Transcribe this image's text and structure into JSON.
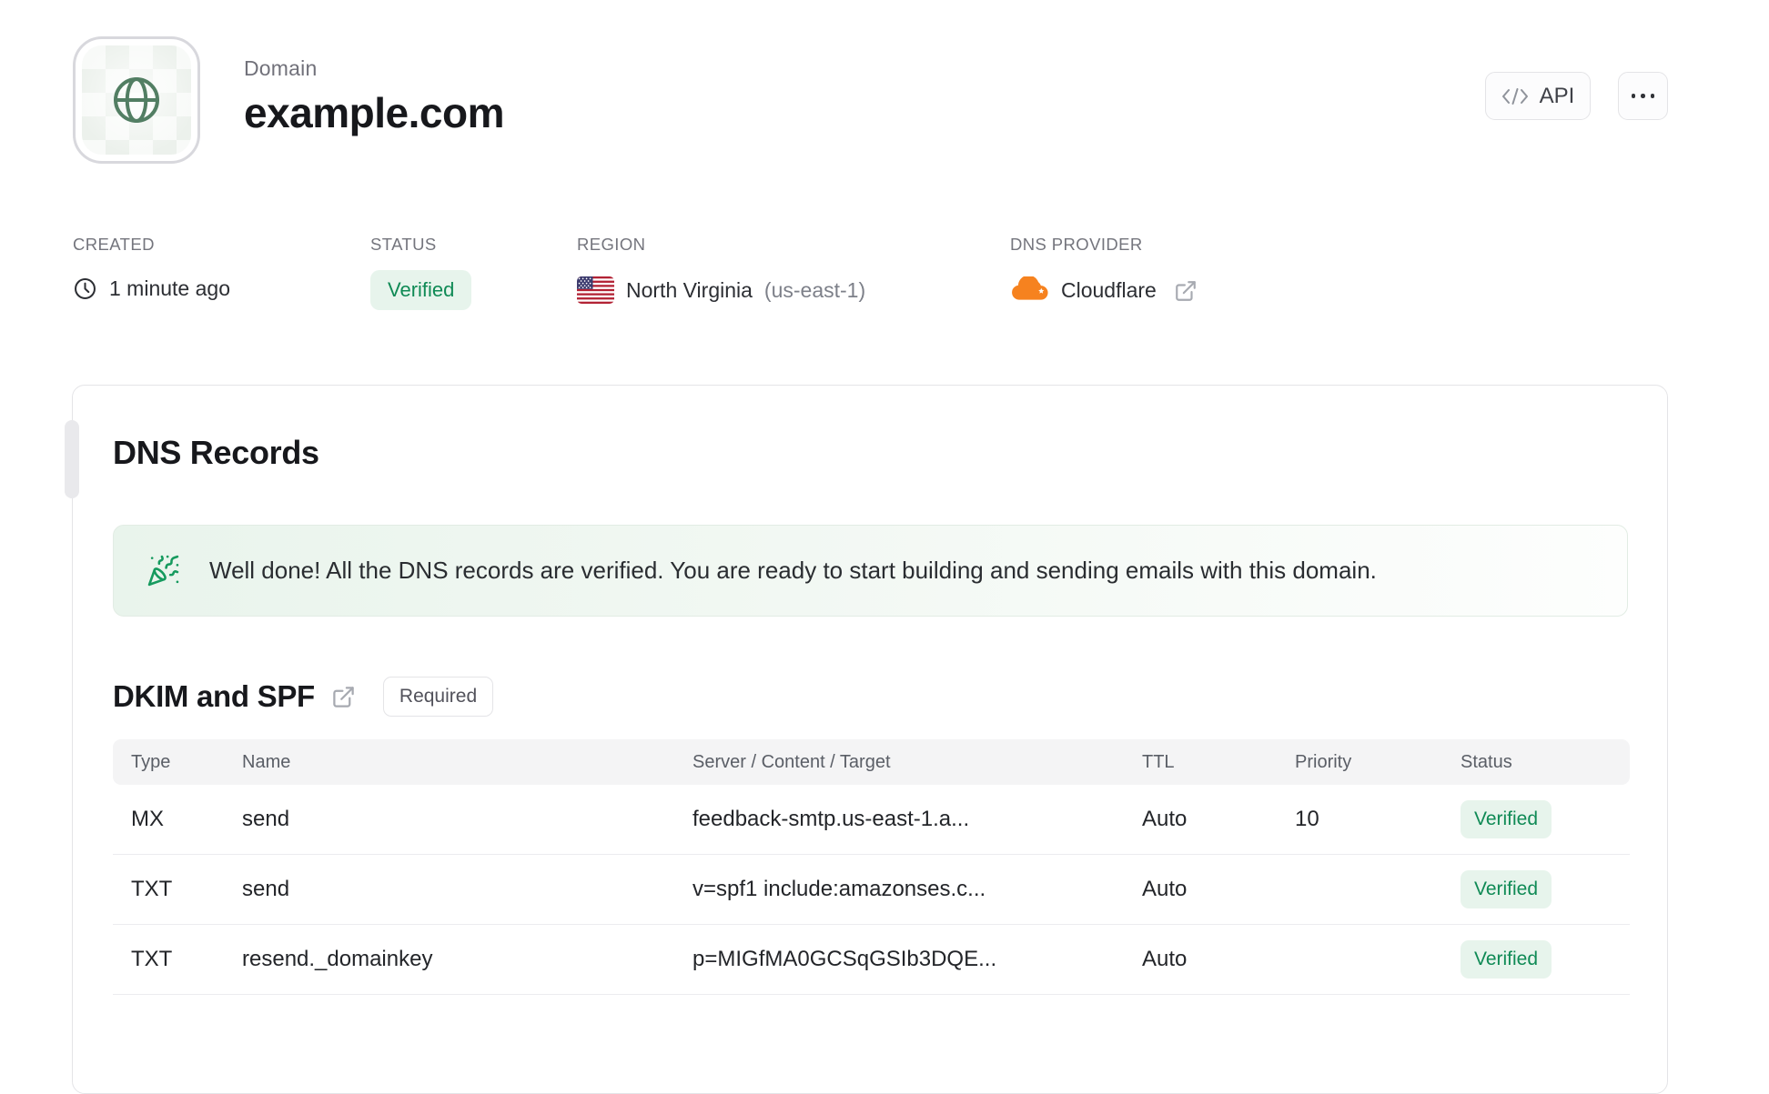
{
  "header": {
    "label": "Domain",
    "title": "example.com",
    "api_button": "API"
  },
  "meta": {
    "created": {
      "label": "CREATED",
      "value": "1 minute ago"
    },
    "status": {
      "label": "STATUS",
      "value": "Verified"
    },
    "region": {
      "label": "REGION",
      "value": "North Virginia",
      "code": "(us-east-1)"
    },
    "dns_provider": {
      "label": "DNS PROVIDER",
      "value": "Cloudflare"
    }
  },
  "card": {
    "title": "DNS Records",
    "banner_message": "Well done! All the DNS records are verified. You are ready to start building and sending emails with this domain.",
    "section_title": "DKIM and SPF",
    "section_badge": "Required"
  },
  "table": {
    "headers": [
      "Type",
      "Name",
      "Server / Content / Target",
      "TTL",
      "Priority",
      "Status"
    ],
    "rows": [
      {
        "type": "MX",
        "name": "send",
        "content": "feedback-smtp.us-east-1.a...",
        "ttl": "Auto",
        "priority": "10",
        "status": "Verified"
      },
      {
        "type": "TXT",
        "name": "send",
        "content": "v=spf1 include:amazonses.c...",
        "ttl": "Auto",
        "priority": "",
        "status": "Verified"
      },
      {
        "type": "TXT",
        "name": "resend._domainkey",
        "content": "p=MIGfMA0GCSqGSIb3DQE...",
        "ttl": "Auto",
        "priority": "",
        "status": "Verified"
      }
    ]
  },
  "colors": {
    "accent_green": "#0f8a55",
    "badge_green_bg": "#e7f4ec",
    "globe_green": "#527e63",
    "cloudflare_orange": "#f6821f",
    "border": "#e4e4e7",
    "table_header_bg": "#f4f4f5"
  }
}
